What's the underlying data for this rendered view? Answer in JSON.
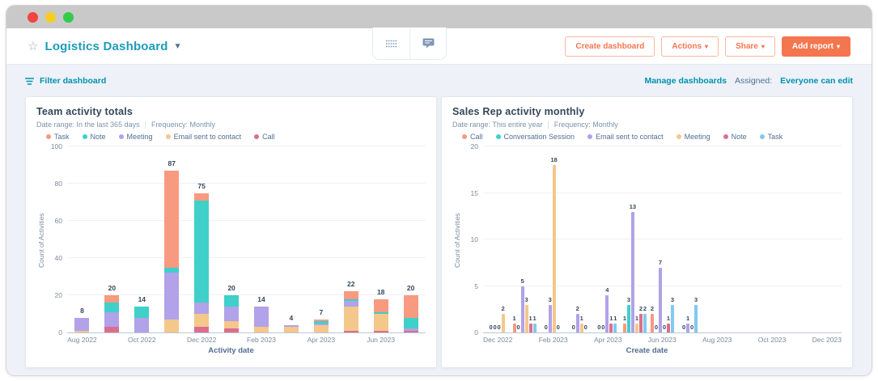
{
  "window": {
    "traffic_lights": [
      "#f2453d",
      "#f6ce21",
      "#32cb4a"
    ]
  },
  "header": {
    "star_icon": "☆",
    "title": "Logistics Dashboard",
    "caret": "▼",
    "buttons": {
      "create_dashboard": "Create dashboard",
      "actions": "Actions",
      "share": "Share",
      "add_report": "Add report",
      "menu_caret": "▾"
    }
  },
  "toolbar": {
    "filter_label": "Filter dashboard",
    "manage_label": "Manage dashboards",
    "assigned_label": "Assigned:",
    "assigned_value": "Everyone can edit"
  },
  "colors": {
    "accent_orange": "#f4764f",
    "link_teal": "#0091ae",
    "title_teal": "#1d9cba",
    "heading": "#33475b",
    "coral": "#f89a80",
    "teal": "#3fd0c9",
    "purple": "#b1a2e9",
    "tan": "#f4c78b",
    "pink": "#dc6e8d",
    "blue": "#82c8f0"
  },
  "chart_data": [
    {
      "type": "bar",
      "stacked": true,
      "title": "Team activity totals",
      "date_range": "Date range: In the last 365 days",
      "separator": "|",
      "frequency": "Frequency: Monthly",
      "xlabel": "Activity date",
      "ylabel": "Count of Activities",
      "ylim": [
        0,
        100
      ],
      "yticks": [
        0,
        20,
        40,
        60,
        80,
        100
      ],
      "tick_every": 2,
      "legend_position": "top",
      "grid": true,
      "categories": [
        "Aug 2022",
        "Sep 2022",
        "Oct 2022",
        "Nov 2022",
        "Dec 2022",
        "Jan 2023",
        "Feb 2023",
        "Mar 2023",
        "Apr 2023",
        "May 2023",
        "Jun 2023",
        "Jul 2023"
      ],
      "stack_order": [
        "Call",
        "Email sent to contact",
        "Meeting",
        "Note",
        "Task"
      ],
      "totals": [
        8,
        20,
        14,
        87,
        75,
        20,
        14,
        4,
        7,
        22,
        18,
        20
      ],
      "series": [
        {
          "name": "Task",
          "color": "#f89a80",
          "values": [
            0,
            4,
            0,
            52,
            4,
            0,
            0,
            0,
            1,
            4,
            7,
            12
          ]
        },
        {
          "name": "Note",
          "color": "#3fd0c9",
          "values": [
            0,
            5,
            6,
            3,
            55,
            6,
            0,
            0,
            1,
            1,
            1,
            6
          ]
        },
        {
          "name": "Meeting",
          "color": "#b1a2e9",
          "values": [
            7,
            8,
            8,
            25,
            6,
            8,
            11,
            1,
            1,
            3,
            0,
            1
          ]
        },
        {
          "name": "Email sent to contact",
          "color": "#f4c78b",
          "values": [
            1,
            0,
            0,
            7,
            7,
            4,
            3,
            3,
            4,
            13,
            9,
            0
          ]
        },
        {
          "name": "Call",
          "color": "#dc6e8d",
          "values": [
            0,
            3,
            0,
            0,
            3,
            2,
            0,
            0,
            0,
            1,
            1,
            1
          ]
        }
      ]
    },
    {
      "type": "bar",
      "stacked": false,
      "title": "Sales Rep activity monthly",
      "date_range": "Date range: This entire year",
      "separator": "|",
      "frequency": "Frequency: Monthly",
      "xlabel": "Create date",
      "ylabel": "Count of Activities",
      "ylim": [
        0,
        20
      ],
      "yticks": [
        0,
        5,
        10,
        15,
        20
      ],
      "tick_every": 2,
      "legend_position": "top",
      "grid": true,
      "categories": [
        "Dec 2022",
        "Jan 2023",
        "Feb 2023",
        "Mar 2023",
        "Apr 2023",
        "May 2023",
        "Jun 2023",
        "Jul 2023",
        "Aug 2023",
        "Sep 2023",
        "Oct 2023",
        "Nov 2023",
        "Dec 2023"
      ],
      "series": [
        {
          "name": "Call",
          "color": "#f89a80",
          "values": [
            0,
            1,
            0,
            0,
            0,
            1,
            2,
            0,
            null,
            null,
            null,
            null,
            null
          ]
        },
        {
          "name": "Conversation Session",
          "color": "#3fd0c9",
          "values": [
            0,
            0,
            null,
            null,
            0,
            3,
            0,
            null,
            null,
            null,
            null,
            null,
            null
          ]
        },
        {
          "name": "Email sent to contact",
          "color": "#b1a2e9",
          "values": [
            0,
            5,
            3,
            2,
            4,
            13,
            7,
            1,
            null,
            null,
            null,
            null,
            null
          ]
        },
        {
          "name": "Meeting",
          "color": "#f4c78b",
          "values": [
            2,
            3,
            18,
            1,
            null,
            1,
            0,
            0,
            null,
            null,
            null,
            null,
            null
          ]
        },
        {
          "name": "Note",
          "color": "#dc6e8d",
          "values": [
            null,
            1,
            0,
            0,
            1,
            2,
            1,
            null,
            null,
            null,
            null,
            null,
            null
          ]
        },
        {
          "name": "Task",
          "color": "#82c8f0",
          "values": [
            null,
            1,
            null,
            null,
            1,
            2,
            3,
            3,
            null,
            null,
            null,
            null,
            null
          ]
        }
      ]
    }
  ]
}
